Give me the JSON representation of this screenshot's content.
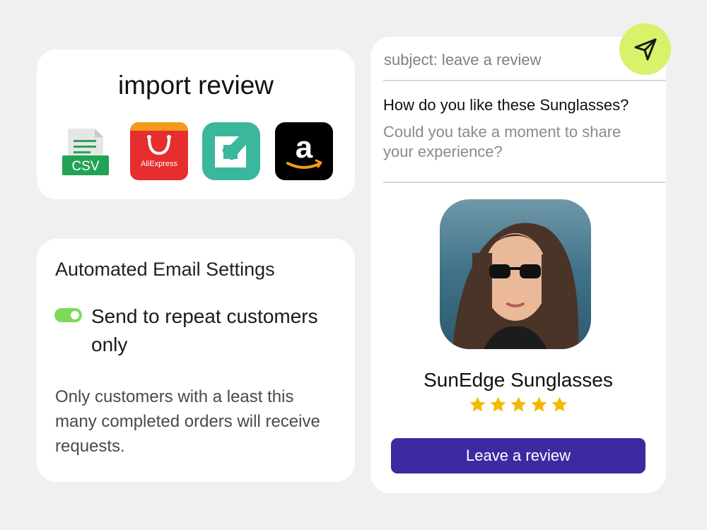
{
  "import_card": {
    "title": "import review",
    "logos": {
      "csv": "CSV",
      "aliexpress": "AliExpress",
      "checkmark_app": "checkmark-app-icon",
      "amazon": "amazon-logo"
    }
  },
  "settings_card": {
    "title": "Automated Email Settings",
    "toggle_label": "Send to repeat customers only",
    "toggle_on": true,
    "description": "Only customers with a least  this many completed orders will receive requests."
  },
  "review_card": {
    "subject": "subject: leave a review",
    "question": "How do you like these Sunglasses?",
    "prompt": "Could you take a moment to share your experience?",
    "product_name": "SunEdge Sunglasses",
    "rating": 5,
    "button_label": "Leave a review"
  },
  "send_button": {
    "icon": "paper-plane-icon"
  },
  "colors": {
    "background": "#f0f0f0",
    "toggle_on": "#7ed957",
    "primary_button": "#3d2aa0",
    "send_button": "#d8f26a",
    "star": "#f5b800"
  }
}
